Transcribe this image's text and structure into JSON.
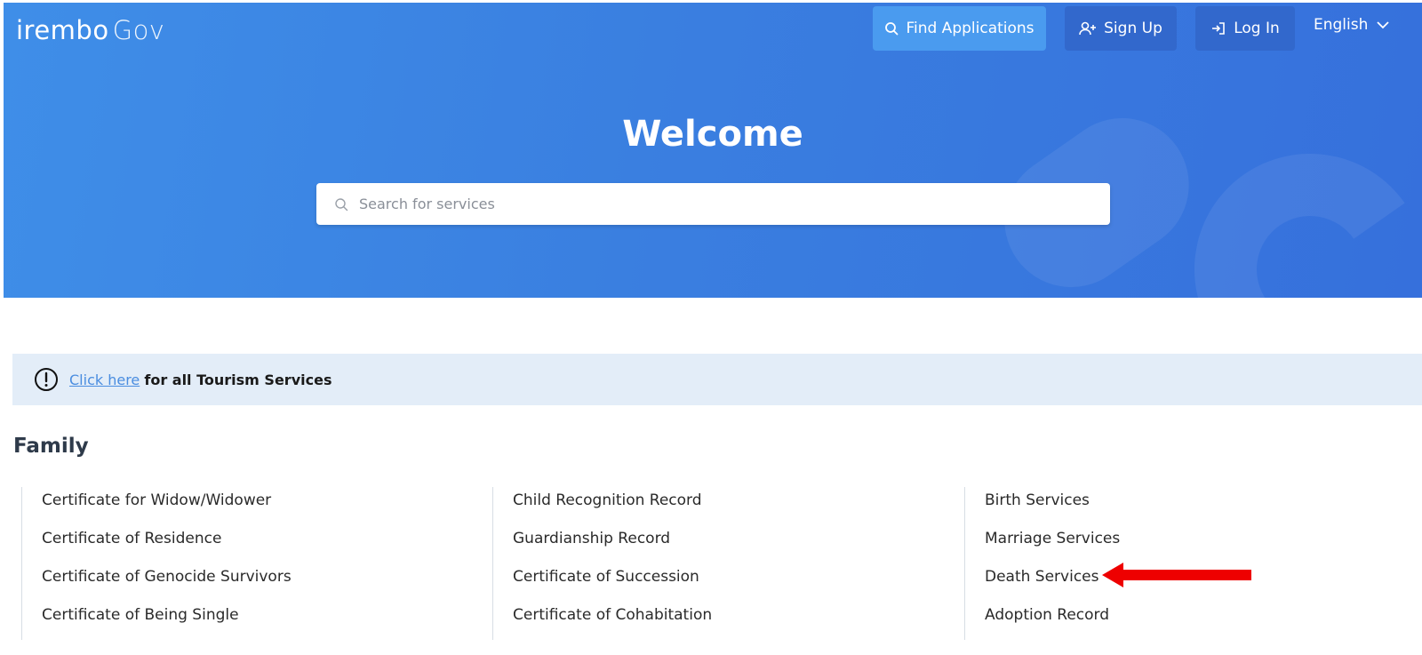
{
  "header": {
    "logo_main": "irembo",
    "logo_gov": "Gov",
    "find_applications": "Find Applications",
    "sign_up": "Sign Up",
    "log_in": "Log In",
    "language": "English"
  },
  "hero": {
    "title": "Welcome",
    "search_placeholder": "Search for services"
  },
  "notice": {
    "link_text": "Click here",
    "text": "for all Tourism Services"
  },
  "family": {
    "title": "Family",
    "columns": [
      [
        "Certificate for Widow/Widower",
        "Certificate of Residence",
        "Certificate of Genocide Survivors",
        "Certificate of Being Single"
      ],
      [
        "Child Recognition Record",
        "Guardianship Record",
        "Certificate of Succession",
        "Certificate of Cohabitation"
      ],
      [
        "Birth Services",
        "Marriage Services",
        "Death Services",
        "Adoption Record"
      ]
    ]
  },
  "colors": {
    "hero_blue": "#3a7fe0",
    "find_button": "#4a9bef",
    "nav_button": "#3268cc",
    "notice_bg": "#e3edf8",
    "link": "#4a8de0",
    "annotation_arrow": "#ee0000"
  },
  "icons": {
    "find": "search-icon",
    "sign_up": "user-plus-icon",
    "log_in": "login-icon",
    "language": "chevron-down-icon",
    "notice": "exclamation-circle-icon"
  }
}
